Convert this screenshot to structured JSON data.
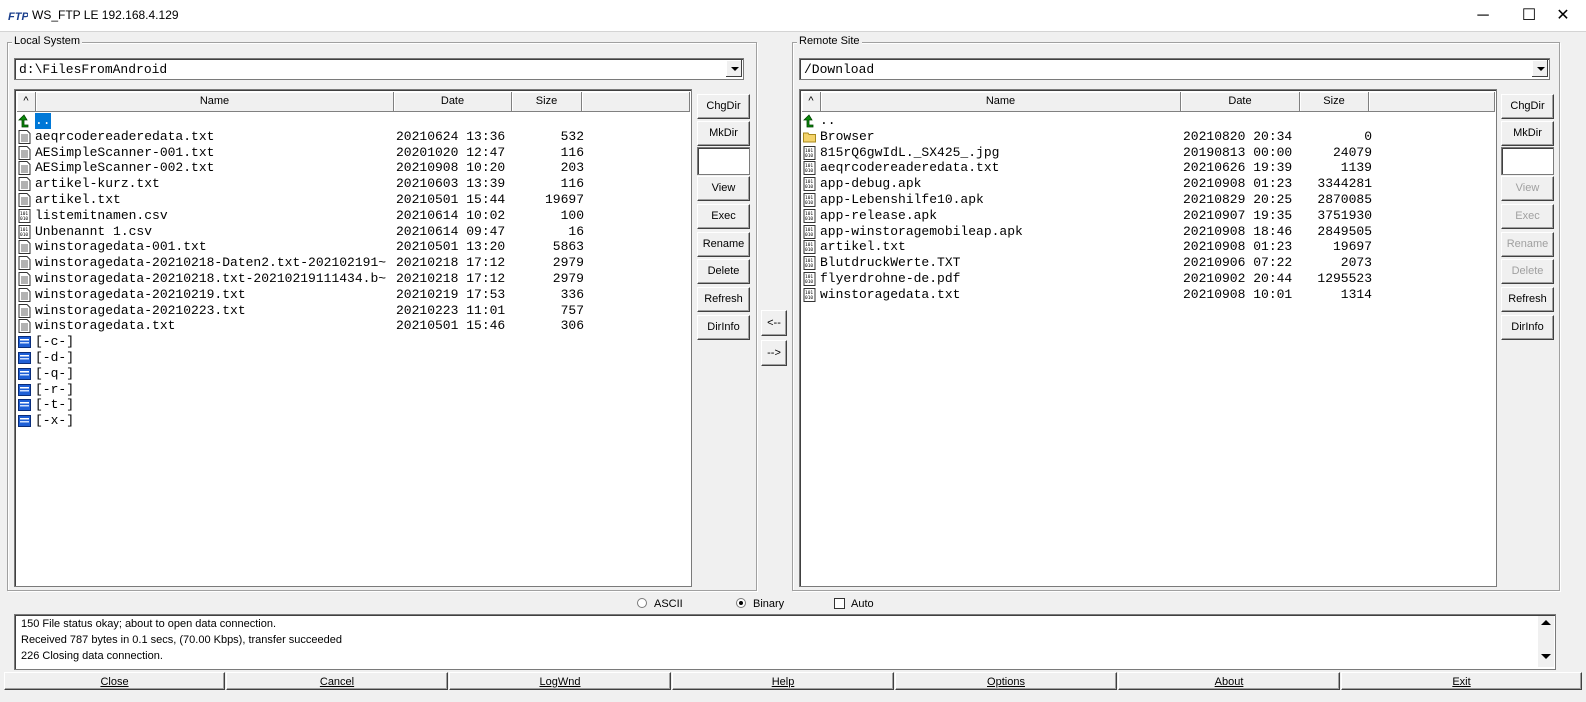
{
  "window": {
    "title": "WS_FTP LE 192.168.4.129",
    "min": "─",
    "max": "☐",
    "close": "✕"
  },
  "local": {
    "group_label": "Local System",
    "path": "d:\\FilesFromAndroid",
    "columns": {
      "sort": "^",
      "name": "Name",
      "date": "Date",
      "size": "Size"
    },
    "rows": [
      {
        "icon": "up-arrow-icon",
        "name": "..",
        "date": "",
        "size": "",
        "selected": true
      },
      {
        "icon": "text-file-icon",
        "name": "aeqrcodereaderedata.txt",
        "date": "20210624 13:36",
        "size": "532"
      },
      {
        "icon": "text-file-icon",
        "name": "AESimpleScanner-001.txt",
        "date": "20201020 12:47",
        "size": "116"
      },
      {
        "icon": "text-file-icon",
        "name": "AESimpleScanner-002.txt",
        "date": "20210908 10:20",
        "size": "203"
      },
      {
        "icon": "text-file-icon",
        "name": "artikel-kurz.txt",
        "date": "20210603 13:39",
        "size": "116"
      },
      {
        "icon": "text-file-icon",
        "name": "artikel.txt",
        "date": "20210501 15:44",
        "size": "19697"
      },
      {
        "icon": "binary-file-icon",
        "name": "listemitnamen.csv",
        "date": "20210614 10:02",
        "size": "100"
      },
      {
        "icon": "binary-file-icon",
        "name": "Unbenannt 1.csv",
        "date": "20210614 09:47",
        "size": "16"
      },
      {
        "icon": "text-file-icon",
        "name": "winstoragedata-001.txt",
        "date": "20210501 13:20",
        "size": "5863"
      },
      {
        "icon": "text-file-icon",
        "name": "winstoragedata-20210218-Daten2.txt-202102191~",
        "date": "20210218 17:12",
        "size": "2979"
      },
      {
        "icon": "text-file-icon",
        "name": "winstoragedata-20210218.txt-20210219111434.b~",
        "date": "20210218 17:12",
        "size": "2979"
      },
      {
        "icon": "text-file-icon",
        "name": "winstoragedata-20210219.txt",
        "date": "20210219 17:53",
        "size": "336"
      },
      {
        "icon": "text-file-icon",
        "name": "winstoragedata-20210223.txt",
        "date": "20210223 11:01",
        "size": "757"
      },
      {
        "icon": "text-file-icon",
        "name": "winstoragedata.txt",
        "date": "20210501 15:46",
        "size": "306"
      },
      {
        "icon": "drive-icon",
        "name": "[-c-]",
        "date": "",
        "size": ""
      },
      {
        "icon": "drive-icon",
        "name": "[-d-]",
        "date": "",
        "size": ""
      },
      {
        "icon": "drive-icon",
        "name": "[-q-]",
        "date": "",
        "size": ""
      },
      {
        "icon": "drive-icon",
        "name": "[-r-]",
        "date": "",
        "size": ""
      },
      {
        "icon": "drive-icon",
        "name": "[-t-]",
        "date": "",
        "size": ""
      },
      {
        "icon": "drive-icon",
        "name": "[-x-]",
        "date": "",
        "size": ""
      }
    ],
    "buttons": {
      "chgdir": "ChgDir",
      "mkdir": "MkDir",
      "view": "View",
      "exec": "Exec",
      "rename": "Rename",
      "delete": "Delete",
      "refresh": "Refresh",
      "dirinfo": "DirInfo"
    }
  },
  "remote": {
    "group_label": "Remote Site",
    "path": "/Download",
    "columns": {
      "sort": "^",
      "name": "Name",
      "date": "Date",
      "size": "Size"
    },
    "rows": [
      {
        "icon": "up-arrow-icon",
        "name": "..",
        "date": "",
        "size": ""
      },
      {
        "icon": "folder-icon",
        "name": "Browser",
        "date": "20210820 20:34",
        "size": "0"
      },
      {
        "icon": "binary-file-icon",
        "name": "815rQ6gwIdL._SX425_.jpg",
        "date": "20190813 00:00",
        "size": "24079"
      },
      {
        "icon": "binary-file-icon",
        "name": "aeqrcodereaderedata.txt",
        "date": "20210626 19:39",
        "size": "1139"
      },
      {
        "icon": "binary-file-icon",
        "name": "app-debug.apk",
        "date": "20210908 01:23",
        "size": "3344281"
      },
      {
        "icon": "binary-file-icon",
        "name": "app-Lebenshilfe10.apk",
        "date": "20210829 20:25",
        "size": "2870085"
      },
      {
        "icon": "binary-file-icon",
        "name": "app-release.apk",
        "date": "20210907 19:35",
        "size": "3751930"
      },
      {
        "icon": "binary-file-icon",
        "name": "app-winstoragemobileap.apk",
        "date": "20210908 18:46",
        "size": "2849505"
      },
      {
        "icon": "binary-file-icon",
        "name": "artikel.txt",
        "date": "20210908 01:23",
        "size": "19697"
      },
      {
        "icon": "binary-file-icon",
        "name": "BlutdruckWerte.TXT",
        "date": "20210906 07:22",
        "size": "2073"
      },
      {
        "icon": "binary-file-icon",
        "name": "flyerdrohne-de.pdf",
        "date": "20210902 20:44",
        "size": "1295523"
      },
      {
        "icon": "binary-file-icon",
        "name": "winstoragedata.txt",
        "date": "20210908 10:01",
        "size": "1314"
      }
    ],
    "buttons": {
      "chgdir": "ChgDir",
      "mkdir": "MkDir",
      "view": "View",
      "exec": "Exec",
      "rename": "Rename",
      "delete": "Delete",
      "refresh": "Refresh",
      "dirinfo": "DirInfo"
    }
  },
  "transfer": {
    "to_local": "<--",
    "to_remote": "-->"
  },
  "mode": {
    "ascii": "ASCII",
    "binary": "Binary",
    "auto": "Auto",
    "selected": "Binary"
  },
  "log": [
    "150 File status okay; about to open data connection.",
    "Received 787 bytes in 0.1 secs, (70.00 Kbps), transfer succeeded",
    "226 Closing data connection."
  ],
  "bottom": {
    "close": "Close",
    "cancel": "Cancel",
    "logwnd": "LogWnd",
    "help": "Help",
    "options": "Options",
    "about": "About",
    "exit": "Exit"
  }
}
